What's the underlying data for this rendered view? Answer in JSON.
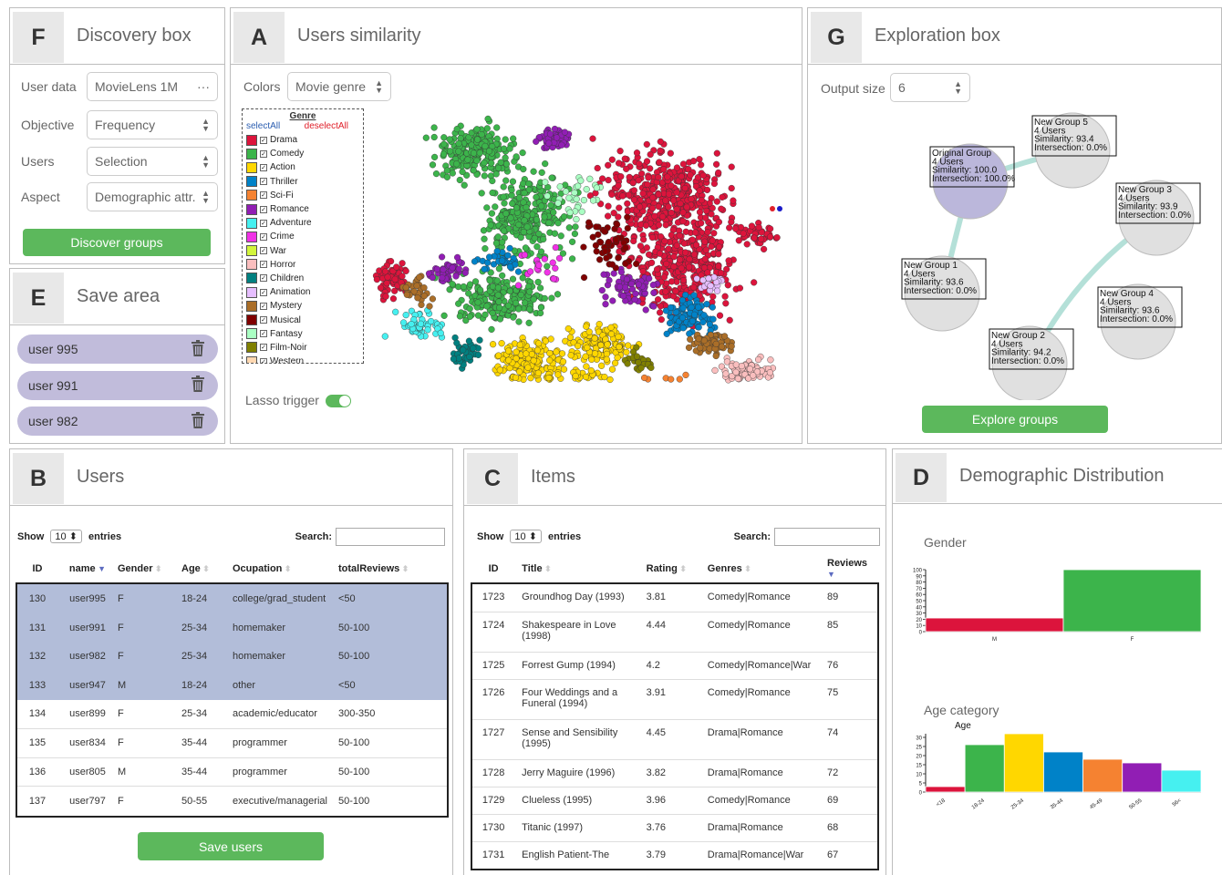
{
  "panels": {
    "discovery": {
      "letter": "F",
      "title": "Discovery box"
    },
    "similarity": {
      "letter": "A",
      "title": "Users similarity"
    },
    "exploration": {
      "letter": "G",
      "title": "Exploration box"
    },
    "save": {
      "letter": "E",
      "title": "Save area"
    },
    "users": {
      "letter": "B",
      "title": "Users"
    },
    "items": {
      "letter": "C",
      "title": "Items"
    },
    "demo": {
      "letter": "D",
      "title": "Demographic Distribution"
    }
  },
  "discovery": {
    "user_data_label": "User data",
    "user_data_value": "MovieLens 1M",
    "user_data_more": "···",
    "objective_label": "Objective",
    "objective_value": "Frequency",
    "users_label": "Users",
    "users_value": "Selection",
    "aspect_label": "Aspect",
    "aspect_value": "Demographic attr.",
    "button": "Discover groups"
  },
  "save_area": {
    "items": [
      "user 995",
      "user 991",
      "user 982"
    ],
    "trash_icon": "trash-icon"
  },
  "similarity": {
    "colors_label": "Colors",
    "colors_value": "Movie genre",
    "legend_title": "Genre",
    "select_all": "selectAll",
    "deselect_all": "deselectAll",
    "genres": [
      {
        "name": "Drama",
        "color": "#dc143c"
      },
      {
        "name": "Comedy",
        "color": "#3cb44b"
      },
      {
        "name": "Action",
        "color": "#ffd700"
      },
      {
        "name": "Thriller",
        "color": "#0082c8"
      },
      {
        "name": "Sci-Fi",
        "color": "#f58231"
      },
      {
        "name": "Romance",
        "color": "#911eb4"
      },
      {
        "name": "Adventure",
        "color": "#46f0f0"
      },
      {
        "name": "Crime",
        "color": "#f032e6"
      },
      {
        "name": "War",
        "color": "#d2f53c"
      },
      {
        "name": "Horror",
        "color": "#fabebe"
      },
      {
        "name": "Children",
        "color": "#008080"
      },
      {
        "name": "Animation",
        "color": "#e6beff"
      },
      {
        "name": "Mystery",
        "color": "#aa6e28"
      },
      {
        "name": "Musical",
        "color": "#800000"
      },
      {
        "name": "Fantasy",
        "color": "#aaffc3"
      },
      {
        "name": "Film-Noir",
        "color": "#808000"
      },
      {
        "name": "Western",
        "color": "#ffd8b1"
      }
    ],
    "lasso_label": "Lasso trigger"
  },
  "exploration": {
    "output_label": "Output size",
    "output_value": "6",
    "button": "Explore groups",
    "groups": [
      {
        "name": "Original Group",
        "users": "4 Users",
        "similarity": "Similarity: 100.0",
        "intersection": "Intersection: 100.0%"
      },
      {
        "name": "New Group 5",
        "users": "4 Users",
        "similarity": "Similarity: 93.4",
        "intersection": "Intersection: 0.0%"
      },
      {
        "name": "New Group 3",
        "users": "4 Users",
        "similarity": "Similarity: 93.9",
        "intersection": "Intersection: 0.0%"
      },
      {
        "name": "New Group 1",
        "users": "4 Users",
        "similarity": "Similarity: 93.6",
        "intersection": "Intersection: 0.0%"
      },
      {
        "name": "New Group 4",
        "users": "4 Users",
        "similarity": "Similarity: 93.6",
        "intersection": "Intersection: 0.0%"
      },
      {
        "name": "New Group 2",
        "users": "4 Users",
        "similarity": "Similarity: 94.2",
        "intersection": "Intersection: 0.0%"
      }
    ]
  },
  "users_table": {
    "show": "Show",
    "entries_value": "10",
    "entries": "entries",
    "search": "Search:",
    "headers": [
      "ID",
      "name",
      "Gender",
      "Age",
      "Ocupation",
      "totalReviews"
    ],
    "rows": [
      [
        "130",
        "user995",
        "F",
        "18-24",
        "college/grad_student",
        "<50"
      ],
      [
        "131",
        "user991",
        "F",
        "25-34",
        "homemaker",
        "50-100"
      ],
      [
        "132",
        "user982",
        "F",
        "25-34",
        "homemaker",
        "50-100"
      ],
      [
        "133",
        "user947",
        "M",
        "18-24",
        "other",
        "<50"
      ],
      [
        "134",
        "user899",
        "F",
        "25-34",
        "academic/educator",
        "300-350"
      ],
      [
        "135",
        "user834",
        "F",
        "35-44",
        "programmer",
        "50-100"
      ],
      [
        "136",
        "user805",
        "M",
        "35-44",
        "programmer",
        "50-100"
      ],
      [
        "137",
        "user797",
        "F",
        "50-55",
        "executive/managerial",
        "50-100"
      ]
    ],
    "selected_rows": 4,
    "button": "Save users"
  },
  "items_table": {
    "show": "Show",
    "entries_value": "10",
    "entries": "entries",
    "search": "Search:",
    "headers": [
      "ID",
      "Title",
      "Rating",
      "Genres",
      "Reviews"
    ],
    "rows": [
      [
        "1723",
        "Groundhog Day (1993)",
        "3.81",
        "Comedy|Romance",
        "89"
      ],
      [
        "1724",
        "Shakespeare in Love (1998)",
        "4.44",
        "Comedy|Romance",
        "85"
      ],
      [
        "1725",
        "Forrest Gump (1994)",
        "4.2",
        "Comedy|Romance|War",
        "76"
      ],
      [
        "1726",
        "Four Weddings and a Funeral (1994)",
        "3.91",
        "Comedy|Romance",
        "75"
      ],
      [
        "1727",
        "Sense and Sensibility (1995)",
        "4.45",
        "Drama|Romance",
        "74"
      ],
      [
        "1728",
        "Jerry Maguire (1996)",
        "3.82",
        "Drama|Romance",
        "72"
      ],
      [
        "1729",
        "Clueless (1995)",
        "3.96",
        "Comedy|Romance",
        "69"
      ],
      [
        "1730",
        "Titanic (1997)",
        "3.76",
        "Drama|Romance",
        "68"
      ],
      [
        "1731",
        "English Patient-The",
        "3.79",
        "Drama|Romance|War",
        "67"
      ]
    ]
  },
  "chart_data": [
    {
      "type": "bar",
      "title": "Gender",
      "categories": [
        "M",
        "F"
      ],
      "values": [
        22,
        100
      ],
      "colors": [
        "#dc143c",
        "#3cb44b"
      ],
      "ylim": [
        0,
        100
      ],
      "yticks": [
        0,
        10,
        20,
        30,
        40,
        50,
        60,
        70,
        80,
        90,
        100
      ]
    },
    {
      "type": "bar",
      "title": "Age category",
      "subtitle": "Age",
      "categories": [
        "<18",
        "18-24",
        "25-34",
        "35-44",
        "45-49",
        "50-55",
        "56<"
      ],
      "values": [
        3,
        26,
        32,
        22,
        18,
        16,
        12
      ],
      "colors": [
        "#dc143c",
        "#3cb44b",
        "#ffd700",
        "#0082c8",
        "#f58231",
        "#911eb4",
        "#46f0f0"
      ],
      "ylim": [
        0,
        32
      ],
      "yticks": [
        0,
        5,
        10,
        15,
        20,
        25,
        30
      ]
    }
  ]
}
